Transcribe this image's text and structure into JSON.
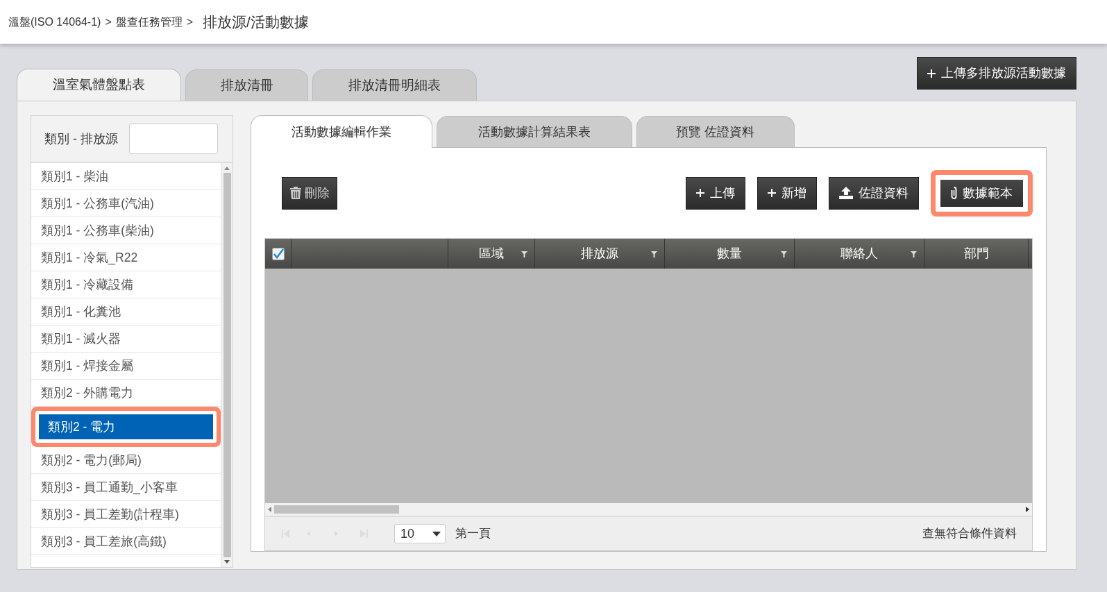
{
  "breadcrumb": {
    "separator": ">",
    "links": [
      "溫盤(ISO 14064-1)",
      "盤查任務管理"
    ],
    "current": "排放源/活動數據"
  },
  "upload_multi_button": {
    "label": "上傳多排放源活動數據"
  },
  "main_tabs": [
    {
      "label": "溫室氣體盤點表",
      "selected": true
    },
    {
      "label": "排放清冊",
      "selected": false
    },
    {
      "label": "排放清冊明細表",
      "selected": false
    }
  ],
  "sidebar": {
    "filter_label": "類別 - 排放源",
    "items": [
      {
        "label": "類別1 - 柴油",
        "selected": false,
        "highlighted": false
      },
      {
        "label": "類別1 - 公務車(汽油)",
        "selected": false,
        "highlighted": false
      },
      {
        "label": "類別1 - 公務車(柴油)",
        "selected": false,
        "highlighted": false
      },
      {
        "label": "類別1 - 冷氣_R22",
        "selected": false,
        "highlighted": false
      },
      {
        "label": "類別1 - 冷藏設備",
        "selected": false,
        "highlighted": false
      },
      {
        "label": "類別1 - 化糞池",
        "selected": false,
        "highlighted": false
      },
      {
        "label": "類別1 - 滅火器",
        "selected": false,
        "highlighted": false
      },
      {
        "label": "類別1 - 焊接金屬",
        "selected": false,
        "highlighted": false
      },
      {
        "label": "類別2 - 外購電力",
        "selected": false,
        "highlighted": false
      },
      {
        "label": "類別2 - 電力",
        "selected": true,
        "highlighted": true
      },
      {
        "label": "類別2 - 電力(郵局)",
        "selected": false,
        "highlighted": false
      },
      {
        "label": "類別3 - 員工通勤_小客車",
        "selected": false,
        "highlighted": false
      },
      {
        "label": "類別3 - 員工差勤(計程車)",
        "selected": false,
        "highlighted": false
      },
      {
        "label": "類別3 - 員工差旅(高鐵)",
        "selected": false,
        "highlighted": false
      }
    ]
  },
  "sub_tabs": [
    {
      "label": "活動數據編輯作業",
      "selected": true
    },
    {
      "label": "活動數據計算結果表",
      "selected": false
    },
    {
      "label": "預覽 佐證資料",
      "selected": false
    }
  ],
  "delete_button": {
    "label": "刪除"
  },
  "toolbar_buttons": [
    {
      "label": "上傳",
      "kind": "plus",
      "highlighted": false
    },
    {
      "label": "新增",
      "kind": "plus",
      "highlighted": false
    },
    {
      "label": "佐證資料",
      "kind": "upload",
      "highlighted": false
    },
    {
      "label": "數據範本",
      "kind": "paperclip",
      "highlighted": true
    }
  ],
  "grid": {
    "select_all_checked": true,
    "columns": [
      {
        "label": "區域",
        "filterable": true
      },
      {
        "label": "排放源",
        "filterable": true
      },
      {
        "label": "數量",
        "filterable": true
      },
      {
        "label": "聯絡人",
        "filterable": true
      },
      {
        "label": "部門",
        "filterable": false
      }
    ]
  },
  "pager": {
    "page_size": "10",
    "page_label": "第一頁",
    "message": "查無符合條件資料"
  }
}
